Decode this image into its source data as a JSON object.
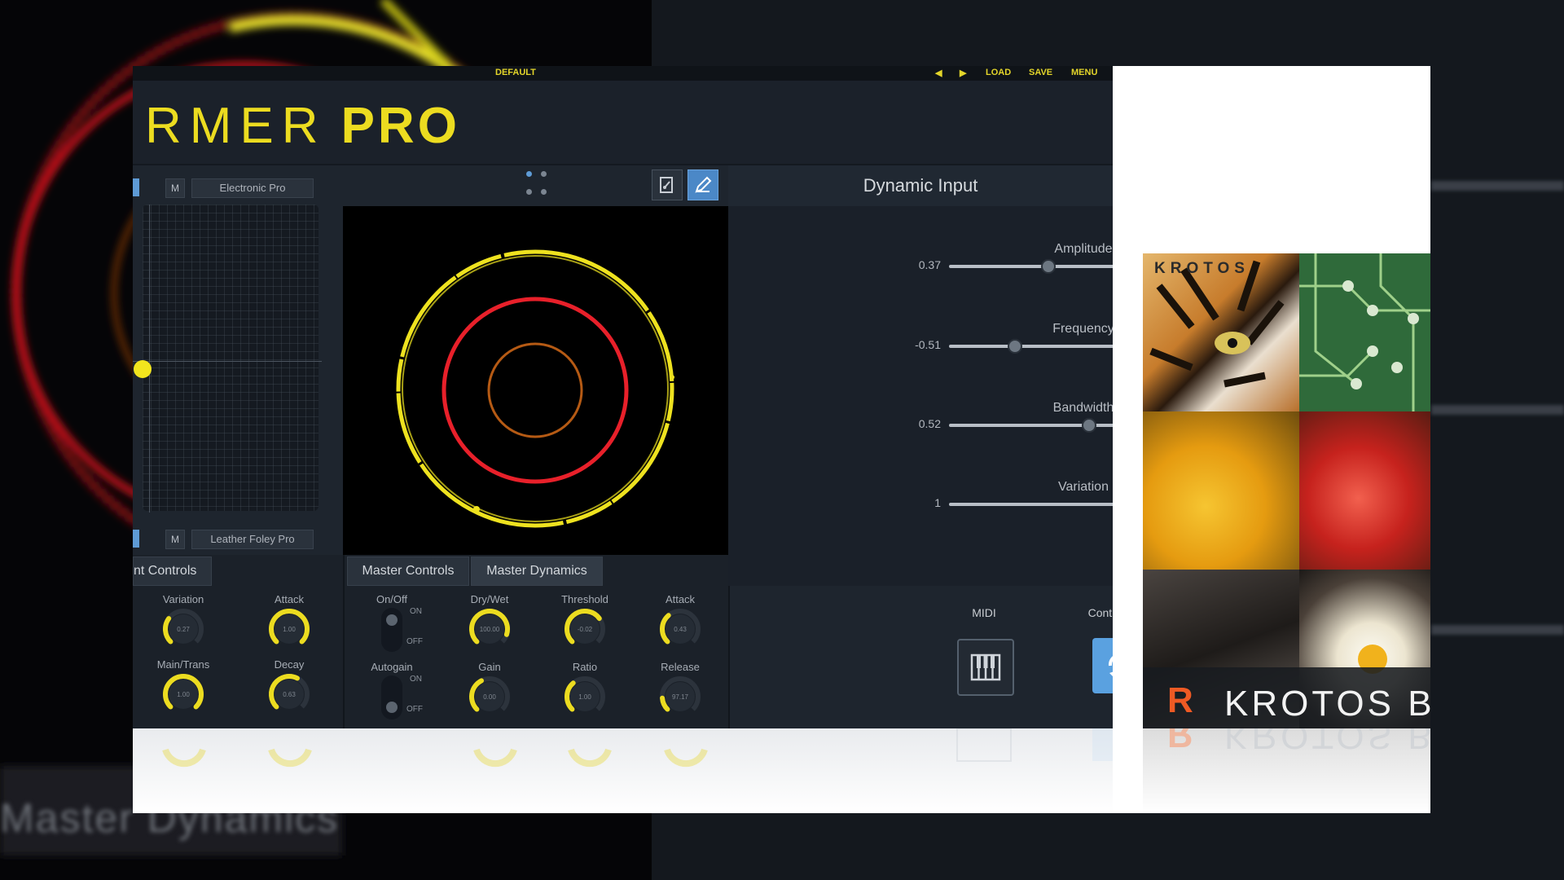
{
  "background": {
    "caption": "Master Dynamics"
  },
  "plugin": {
    "topbar": {
      "preset": "DEFAULT",
      "prev": "◀",
      "next": "▶",
      "load": "LOAD",
      "save": "SAVE",
      "menu": "MENU"
    },
    "title": {
      "main": "RMER",
      "suffix": "PRO"
    },
    "slots": {
      "top": {
        "mute": "M",
        "name": "Electronic Pro"
      },
      "bottom": {
        "mute": "M",
        "name": "Leather Foley Pro"
      }
    },
    "dynamic_input": {
      "title": "Dynamic Input",
      "params": [
        {
          "label": "Amplitude",
          "value": "0.37",
          "fraction": 0.37
        },
        {
          "label": "Frequency",
          "value": "-0.51",
          "fraction": 0.245
        },
        {
          "label": "Bandwidth",
          "value": "0.52",
          "fraction": 0.52
        },
        {
          "label": "Variation",
          "value": "1",
          "fraction": 1.0
        }
      ],
      "midi_label": "MIDI",
      "continuous_label": "Continuous"
    },
    "tabs": {
      "left": "nt Controls",
      "master_controls": "Master Controls",
      "master_dynamics": "Master Dynamics"
    },
    "left_knobs": [
      {
        "label": "Variation",
        "value": "0.27",
        "level": 0.3
      },
      {
        "label": "Attack",
        "value": "1.00",
        "level": 1.0
      },
      {
        "label": "Main/Trans",
        "value": "1.00",
        "level": 1.0
      },
      {
        "label": "Decay",
        "value": "0.63",
        "level": 0.6
      }
    ],
    "toggles": [
      {
        "label": "On/Off",
        "on": "ON",
        "off": "OFF"
      },
      {
        "label": "Autogain",
        "on": "ON",
        "off": "OFF"
      }
    ],
    "master_knobs": [
      {
        "label": "Dry/Wet",
        "value": "100.00",
        "level": 0.9
      },
      {
        "label": "Threshold",
        "value": "-0.02",
        "level": 0.7
      },
      {
        "label": "Attack",
        "value": "0.43",
        "level": 0.35
      },
      {
        "label": "Gain",
        "value": "0.00",
        "level": 0.4
      },
      {
        "label": "Ratio",
        "value": "1.00",
        "level": 0.35
      },
      {
        "label": "Release",
        "value": "97.17",
        "level": 0.15
      }
    ]
  },
  "product": {
    "brand_top": "KROTOS",
    "brand_band": "KROTOS BU",
    "logo_letter": "R"
  },
  "colors": {
    "accent_yellow": "#ecdc20",
    "accent_blue": "#5aa1e0",
    "panel_dark": "#1b212a",
    "ring_red": "#e8202a",
    "ring_orange": "#b55a14",
    "krotos_orange": "#ef5a24"
  },
  "icons": {
    "prev": "triangle-left",
    "next": "triangle-right",
    "midi": "piano-keys-icon",
    "continuous": "refresh-icon",
    "shape_tool": "edit-shape-icon",
    "pen_tool": "pen-icon"
  }
}
